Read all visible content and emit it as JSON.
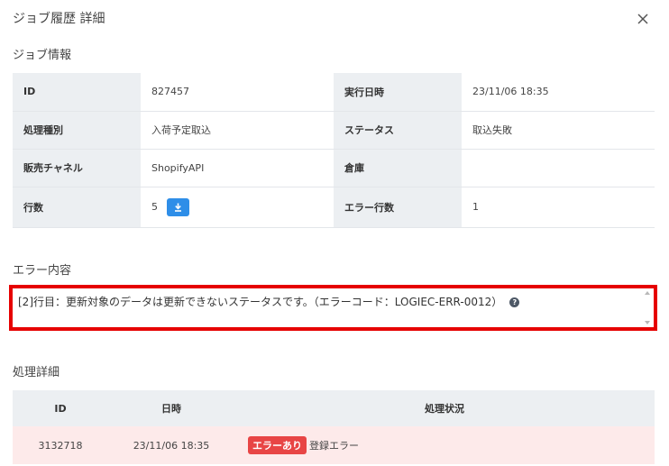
{
  "modal": {
    "title": "ジョブ履歴 詳細"
  },
  "sections": {
    "job_info": "ジョブ情報",
    "error_content": "エラー内容",
    "process_detail": "処理詳細"
  },
  "job_info": {
    "rows": [
      {
        "label1": "ID",
        "value1": "827457",
        "label2": "実行日時",
        "value2": "23/11/06 18:35"
      },
      {
        "label1": "処理種別",
        "value1": "入荷予定取込",
        "label2": "ステータス",
        "value2": "取込失敗"
      },
      {
        "label1": "販売チャネル",
        "value1": "ShopifyAPI",
        "label2": "倉庫",
        "value2": ""
      },
      {
        "label1": "行数",
        "value1": "5",
        "label2": "エラー行数",
        "value2": "1"
      }
    ]
  },
  "error": {
    "message": "[2]行目：更新対象のデータは更新できないステータスです。（エラーコード：LOGIEC-ERR-0012）",
    "help_glyph": "?"
  },
  "detail_table": {
    "headers": {
      "id": "ID",
      "date": "日時",
      "status": "処理状況"
    },
    "rows": [
      {
        "id": "3132718",
        "date": "23/11/06 18:35",
        "badge": "エラーあり",
        "status": "登録エラー"
      }
    ]
  },
  "colors": {
    "accent": "#2e8ee8",
    "error_border": "#e60000",
    "error_badge": "#e84545",
    "error_row": "#fdeaea",
    "label_bg": "#eceff2"
  },
  "icons": [
    "close-icon",
    "download-icon",
    "help-icon",
    "scroll-up-icon",
    "scroll-down-icon"
  ]
}
